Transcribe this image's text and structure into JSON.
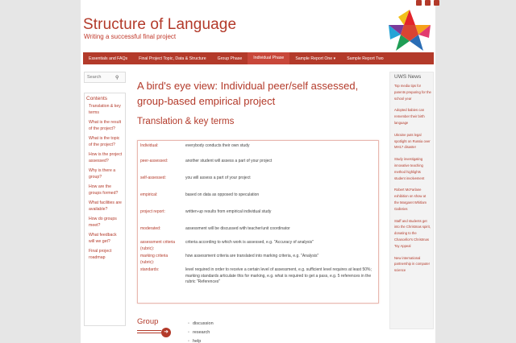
{
  "site": {
    "title": "Structure of Language",
    "tagline": "Writing a successful final project"
  },
  "nav": [
    {
      "label": "Essentials and FAQs",
      "dropdown": false,
      "selected": false
    },
    {
      "label": "Final Project Topic, Data & Structure",
      "dropdown": false,
      "selected": false
    },
    {
      "label": "Group Phase",
      "dropdown": false,
      "selected": false
    },
    {
      "label": "Individual Phase",
      "dropdown": false,
      "selected": true
    },
    {
      "label": "Sample Report One",
      "dropdown": true,
      "selected": false
    },
    {
      "label": "Sample Report Two",
      "dropdown": false,
      "selected": false
    }
  ],
  "search": {
    "placeholder": "Search"
  },
  "toc": {
    "heading": "Contents",
    "items": [
      "Translation & key terms",
      "What is the result of the project?",
      "What is the topic of the project?",
      "How is the project assessed?",
      "Why is there a group?",
      "How are the groups formed?",
      "What facilities are available?",
      "How do groups meet?",
      "What feedback will we get?",
      "Final project roadmap"
    ]
  },
  "main": {
    "title": "A bird's eye view: Individual peer/self assessed, group-based empirical project",
    "subtitle": "Translation & key terms"
  },
  "terms": [
    {
      "term": "Individual:",
      "def": "everybody conducts their own study"
    },
    {
      "term": "peer-assessed:",
      "def": "another student will assess a part of your project"
    },
    {
      "term": "self-assessed:",
      "def": "you will assess a part of your project"
    },
    {
      "term": "empirical:",
      "def": "based on data as opposed to speculation"
    },
    {
      "term": "project report:",
      "def": "written-up results from empirical individual study"
    },
    {
      "term": "moderated:",
      "def": "assessment will be discussed with teacher/unit coordinator"
    },
    {
      "term": "assessment criteria (rubric):",
      "def": "criteria according to which work is assessed, e.g. \"Accuracy of analysis\""
    },
    {
      "term": "marking criteria (rubric):",
      "def": "how assessment criteria are translated into marking criteria, e.g. \"Analysis\""
    },
    {
      "term": "standards:",
      "def": "level required in order to receive a certain level of assessment, e.g. sufficient level requires at least 50%; marking standards articulate this for marking, e.g. what is required to get a pass, e.g. 5 references in the rubric \"References\""
    }
  ],
  "group": {
    "heading": "Group",
    "items": [
      "discussion",
      "research",
      "help"
    ]
  },
  "news": {
    "heading": "UWS News",
    "items": [
      "Top media tips for parents preparing for the school year",
      "Adopted babies can remember their birth language",
      "Ukraine puts legal spotlight on Russia over MH17 disaster",
      "Study investigating innovative teaching method highlights student involvement",
      "Robert McFarlane exhibition on show at the Margaret Whitlam Galleries",
      "Staff and students get into the Christmas spirit, donating to the Chancellor's Christmas Toy Appeal",
      "New international partnership in computer science"
    ]
  },
  "colors": {
    "accent": "#b33a2a",
    "background": "#e6e6e6"
  }
}
